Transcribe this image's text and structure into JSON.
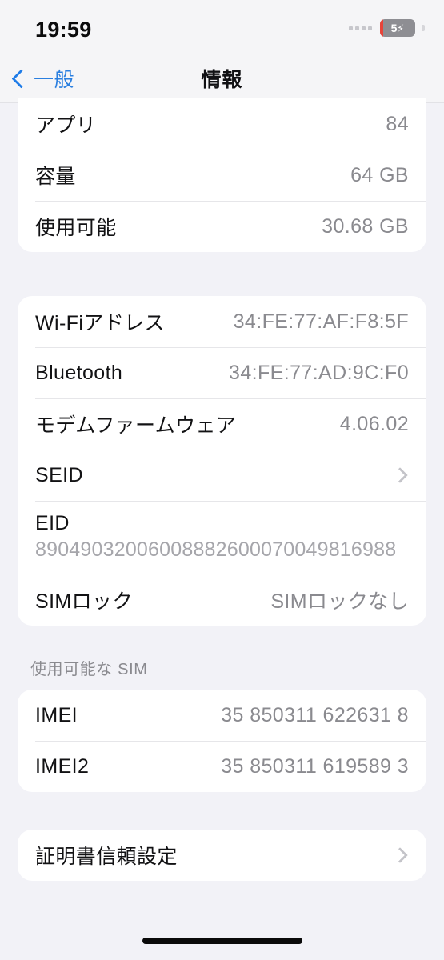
{
  "status_bar": {
    "time": "19:59",
    "battery_level": "5",
    "battery_charging_icon": "bolt-icon",
    "signal_dots_icon": "signal-dots-icon"
  },
  "nav": {
    "back_label": "一般",
    "back_icon": "chevron-left-icon",
    "title": "情報"
  },
  "groups": [
    {
      "id": "storage-group",
      "rows": [
        {
          "label": "アプリ",
          "value": "84",
          "type": "value"
        },
        {
          "label": "容量",
          "value": "64 GB",
          "type": "value"
        },
        {
          "label": "使用可能",
          "value": "30.68 GB",
          "type": "value"
        }
      ]
    },
    {
      "id": "network-group",
      "rows": [
        {
          "label": "Wi-Fiアドレス",
          "value": "34:FE:77:AF:F8:5F",
          "type": "value"
        },
        {
          "label": "Bluetooth",
          "value": "34:FE:77:AD:9C:F0",
          "type": "value"
        },
        {
          "label": "モデムファームウェア",
          "value": "4.06.02",
          "type": "value"
        },
        {
          "label": "SEID",
          "value": "",
          "type": "disclosure"
        },
        {
          "label": "EID",
          "value": "89049032006008882600070049816988",
          "type": "stacked"
        },
        {
          "label": "SIMロック",
          "value": "SIMロックなし",
          "type": "value"
        }
      ]
    },
    {
      "id": "sim-group",
      "header": "使用可能な SIM",
      "rows": [
        {
          "label": "IMEI",
          "value": "35 850311 622631 8",
          "type": "value"
        },
        {
          "label": "IMEI2",
          "value": "35 850311 619589 3",
          "type": "value"
        }
      ]
    },
    {
      "id": "certificate-group",
      "rows": [
        {
          "label": "証明書信頼設定",
          "value": "",
          "type": "disclosure"
        }
      ]
    }
  ],
  "colors": {
    "accent_blue": "#2a7fe0",
    "page_background": "#f2f2f7",
    "card_background": "#ffffff",
    "value_gray": "#8a8a8f",
    "battery_red": "#e8443a"
  }
}
